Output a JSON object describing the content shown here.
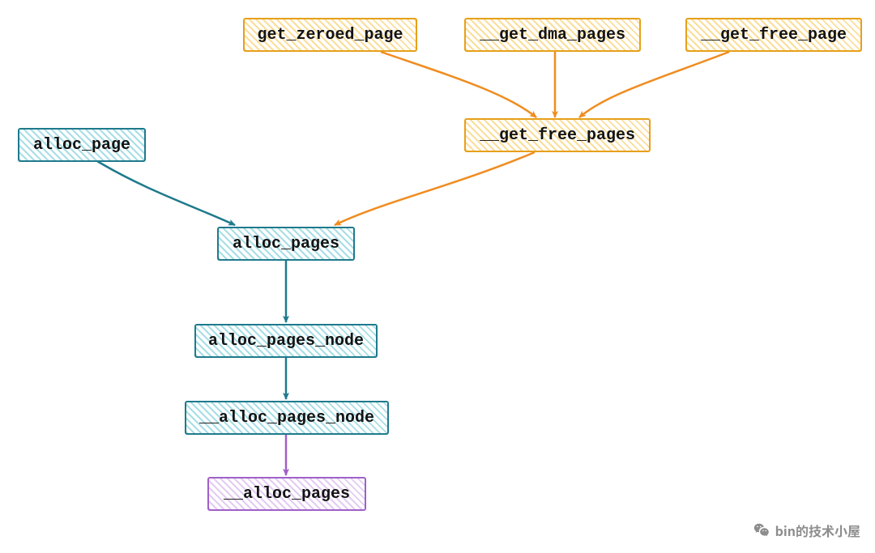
{
  "nodes": {
    "get_zeroed_page": {
      "label": "get_zeroed_page"
    },
    "get_dma_pages": {
      "label": "__get_dma_pages"
    },
    "get_free_page": {
      "label": "__get_free_page"
    },
    "get_free_pages": {
      "label": "__get_free_pages"
    },
    "alloc_page": {
      "label": "alloc_page"
    },
    "alloc_pages": {
      "label": "alloc_pages"
    },
    "alloc_pages_node": {
      "label": "alloc_pages_node"
    },
    "__alloc_pages_node": {
      "label": "__alloc_pages_node"
    },
    "__alloc_pages": {
      "label": "__alloc_pages"
    }
  },
  "edges": [
    {
      "from": "get_zeroed_page",
      "to": "get_free_pages",
      "color": "orange"
    },
    {
      "from": "get_dma_pages",
      "to": "get_free_pages",
      "color": "orange"
    },
    {
      "from": "get_free_page",
      "to": "get_free_pages",
      "color": "orange"
    },
    {
      "from": "get_free_pages",
      "to": "alloc_pages",
      "color": "orange"
    },
    {
      "from": "alloc_page",
      "to": "alloc_pages",
      "color": "teal"
    },
    {
      "from": "alloc_pages",
      "to": "alloc_pages_node",
      "color": "teal"
    },
    {
      "from": "alloc_pages_node",
      "to": "__alloc_pages_node",
      "color": "teal"
    },
    {
      "from": "__alloc_pages_node",
      "to": "__alloc_pages",
      "color": "purple"
    }
  ],
  "colors": {
    "orange": "#f08c1f",
    "teal": "#1f7a8c",
    "purple": "#a060c9"
  },
  "watermark": {
    "text": "bin的技术小屋"
  }
}
